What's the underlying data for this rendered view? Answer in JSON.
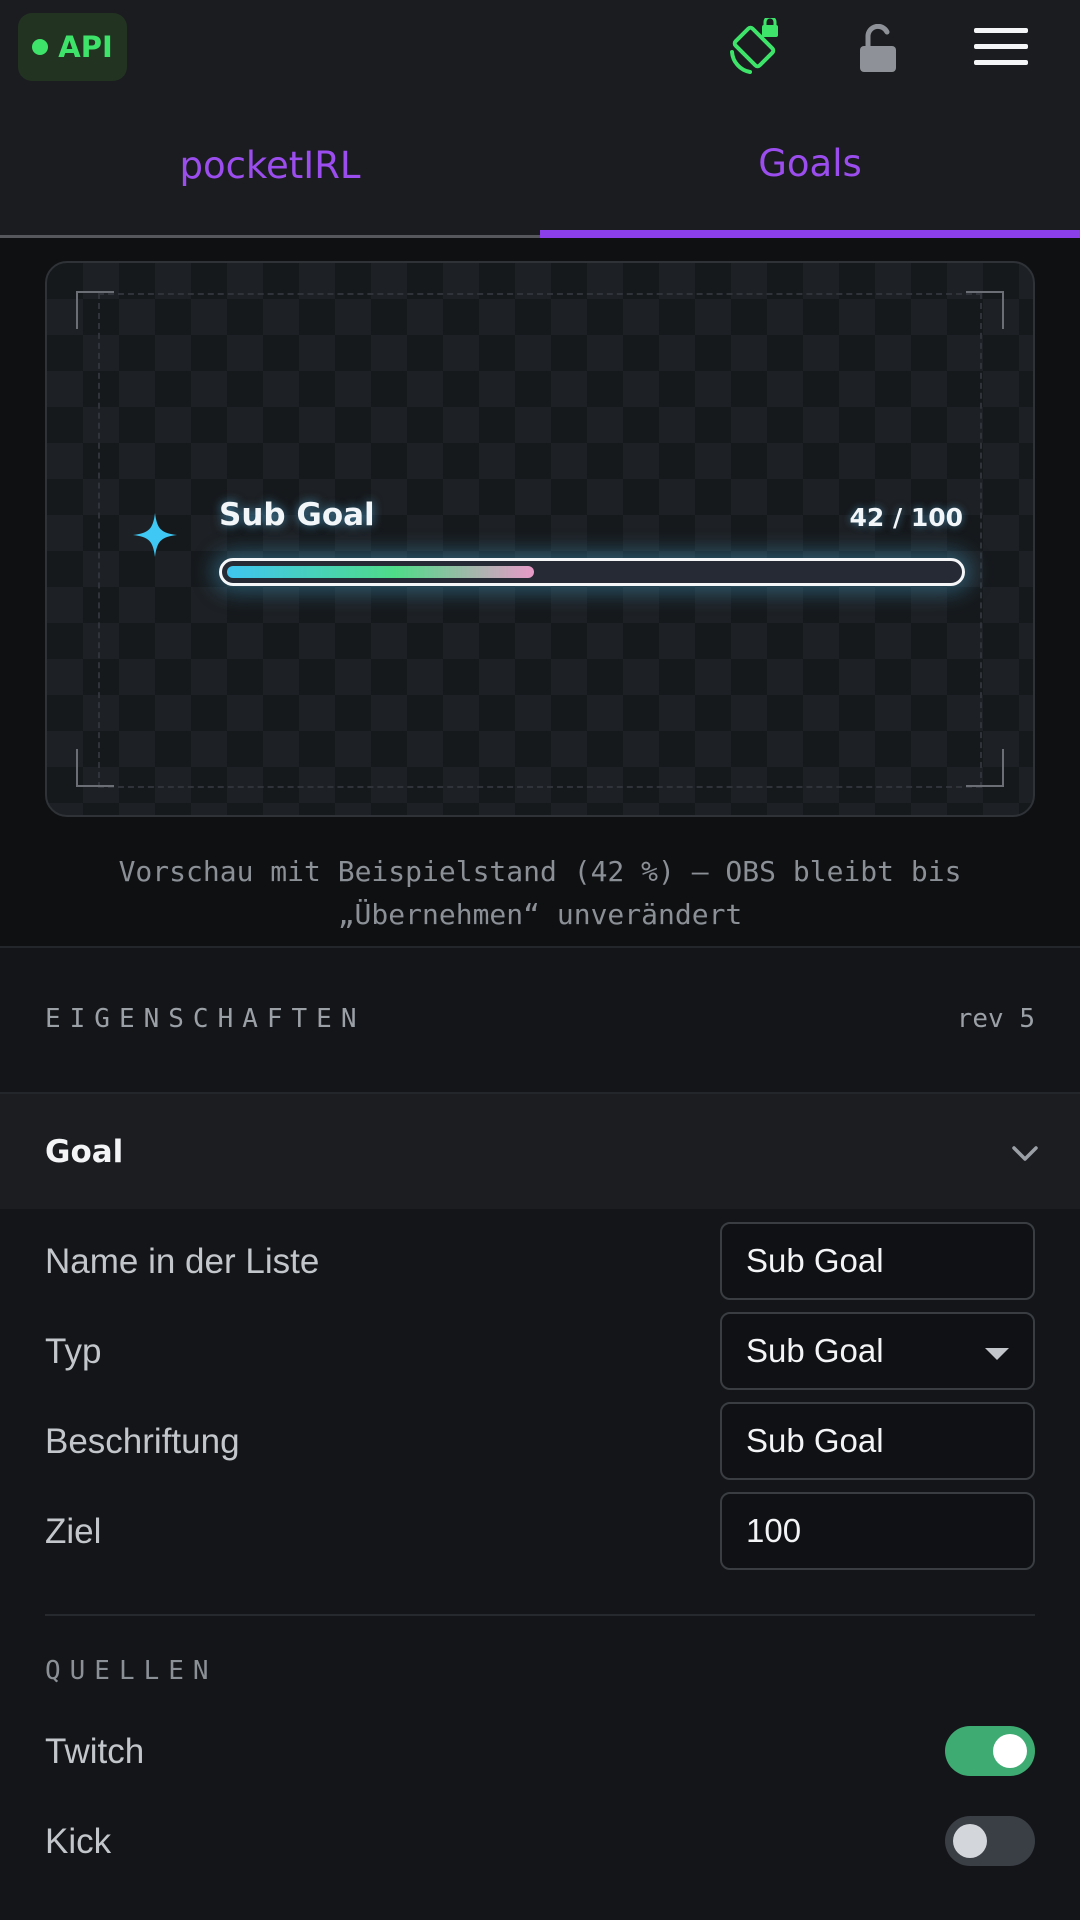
{
  "topbar": {
    "api_label": "API",
    "api_status_color": "#3ee46a",
    "icons": [
      "rotate-lock-icon",
      "lock-open-icon",
      "menu-icon"
    ]
  },
  "tabs": [
    {
      "label": "pocketIRL",
      "active": false
    },
    {
      "label": "Goals",
      "active": true
    }
  ],
  "accent_color": "#8a3fe8",
  "preview": {
    "goal_title": "Sub Goal",
    "goal_count": "42 / 100",
    "progress_fraction": 0.42,
    "caption_line1": "Vorschau mit Beispielstand (42 %) – OBS bleibt bis",
    "caption_line2": "„Übernehmen“ unverändert"
  },
  "properties": {
    "title": "EIGENSCHAFTEN",
    "revision": "rev 5",
    "section_label": "Goal",
    "fields": [
      {
        "label": "Name in der Liste",
        "value": "Sub Goal",
        "kind": "text"
      },
      {
        "label": "Typ",
        "value": "Sub Goal",
        "kind": "select"
      },
      {
        "label": "Beschriftung",
        "value": "Sub Goal",
        "kind": "text"
      },
      {
        "label": "Ziel",
        "value": "100",
        "kind": "number"
      }
    ]
  },
  "sources": {
    "title": "QUELLEN",
    "items": [
      {
        "label": "Twitch",
        "enabled": true
      },
      {
        "label": "Kick",
        "enabled": false
      }
    ]
  }
}
